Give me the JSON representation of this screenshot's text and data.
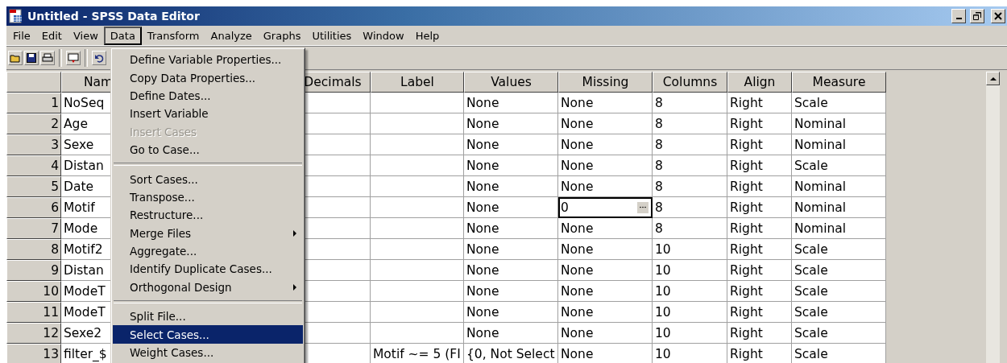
{
  "window": {
    "title": "Untitled - SPSS Data Editor"
  },
  "menu_bar": [
    {
      "label": "File",
      "selected": false
    },
    {
      "label": "Edit",
      "selected": false
    },
    {
      "label": "View",
      "selected": false
    },
    {
      "label": "Data",
      "selected": true
    },
    {
      "label": "Transform",
      "selected": false
    },
    {
      "label": "Analyze",
      "selected": false
    },
    {
      "label": "Graphs",
      "selected": false
    },
    {
      "label": "Utilities",
      "selected": false
    },
    {
      "label": "Window",
      "selected": false
    },
    {
      "label": "Help",
      "selected": false
    }
  ],
  "data_menu": [
    {
      "kind": "item",
      "label": "Define Variable Properties...",
      "disabled": false,
      "selected": false,
      "submenu": false
    },
    {
      "kind": "item",
      "label": "Copy Data Properties...",
      "disabled": false,
      "selected": false,
      "submenu": false
    },
    {
      "kind": "item",
      "label": "Define Dates...",
      "disabled": false,
      "selected": false,
      "submenu": false
    },
    {
      "kind": "item",
      "label": "Insert Variable",
      "disabled": false,
      "selected": false,
      "submenu": false
    },
    {
      "kind": "item",
      "label": "Insert Cases",
      "disabled": true,
      "selected": false,
      "submenu": false
    },
    {
      "kind": "item",
      "label": "Go to Case...",
      "disabled": false,
      "selected": false,
      "submenu": false
    },
    {
      "kind": "separator"
    },
    {
      "kind": "item",
      "label": "Sort Cases...",
      "disabled": false,
      "selected": false,
      "submenu": false
    },
    {
      "kind": "item",
      "label": "Transpose...",
      "disabled": false,
      "selected": false,
      "submenu": false
    },
    {
      "kind": "item",
      "label": "Restructure...",
      "disabled": false,
      "selected": false,
      "submenu": false
    },
    {
      "kind": "item",
      "label": "Merge Files",
      "disabled": false,
      "selected": false,
      "submenu": true
    },
    {
      "kind": "item",
      "label": "Aggregate...",
      "disabled": false,
      "selected": false,
      "submenu": false
    },
    {
      "kind": "item",
      "label": "Identify Duplicate Cases...",
      "disabled": false,
      "selected": false,
      "submenu": false
    },
    {
      "kind": "item",
      "label": "Orthogonal Design",
      "disabled": false,
      "selected": false,
      "submenu": true
    },
    {
      "kind": "separator"
    },
    {
      "kind": "item",
      "label": "Split File...",
      "disabled": false,
      "selected": false,
      "submenu": false
    },
    {
      "kind": "item",
      "label": "Select Cases...",
      "disabled": false,
      "selected": true,
      "submenu": false
    },
    {
      "kind": "item",
      "label": "Weight Cases...",
      "disabled": false,
      "selected": false,
      "submenu": false
    }
  ],
  "grid": {
    "columns": [
      "Nam",
      "Decimals",
      "Label",
      "Values",
      "Missing",
      "Columns",
      "Align",
      "Measure"
    ],
    "rows": [
      {
        "number": "1",
        "name": "NoSeq",
        "values": "None",
        "missing": "None",
        "columns": "8",
        "align": "Right",
        "measure": "Scale",
        "editing": false
      },
      {
        "number": "2",
        "name": "Age",
        "values": "None",
        "missing": "None",
        "columns": "8",
        "align": "Right",
        "measure": "Nominal",
        "editing": false
      },
      {
        "number": "3",
        "name": "Sexe",
        "values": "None",
        "missing": "None",
        "columns": "8",
        "align": "Right",
        "measure": "Nominal",
        "editing": false
      },
      {
        "number": "4",
        "name": "Distan",
        "values": "None",
        "missing": "None",
        "columns": "8",
        "align": "Right",
        "measure": "Scale",
        "editing": false
      },
      {
        "number": "5",
        "name": "Date",
        "values": "None",
        "missing": "None",
        "columns": "8",
        "align": "Right",
        "measure": "Nominal",
        "editing": false
      },
      {
        "number": "6",
        "name": "Motif",
        "values": "None",
        "missing": "0",
        "columns": "8",
        "align": "Right",
        "measure": "Nominal",
        "editing": true
      },
      {
        "number": "7",
        "name": "Mode",
        "values": "None",
        "missing": "None",
        "columns": "8",
        "align": "Right",
        "measure": "Nominal",
        "editing": false
      },
      {
        "number": "8",
        "name": "Motif2",
        "values": "None",
        "missing": "None",
        "columns": "10",
        "align": "Right",
        "measure": "Scale",
        "editing": false
      },
      {
        "number": "9",
        "name": "Distan",
        "values": "None",
        "missing": "None",
        "columns": "10",
        "align": "Right",
        "measure": "Scale",
        "editing": false
      },
      {
        "number": "10",
        "name": "ModeT",
        "values": "None",
        "missing": "None",
        "columns": "10",
        "align": "Right",
        "measure": "Scale",
        "editing": false
      },
      {
        "number": "11",
        "name": "ModeT",
        "values": "None",
        "missing": "None",
        "columns": "10",
        "align": "Right",
        "measure": "Scale",
        "editing": false
      },
      {
        "number": "12",
        "name": "Sexe2",
        "values": "None",
        "missing": "None",
        "columns": "10",
        "align": "Right",
        "measure": "Scale",
        "editing": false
      },
      {
        "number": "13",
        "name": "filter_$",
        "label": "Motif ~= 5 (FI",
        "values": "{0, Not Select",
        "missing": "None",
        "columns": "10",
        "align": "Right",
        "measure": "Scale",
        "editing": false
      }
    ]
  }
}
